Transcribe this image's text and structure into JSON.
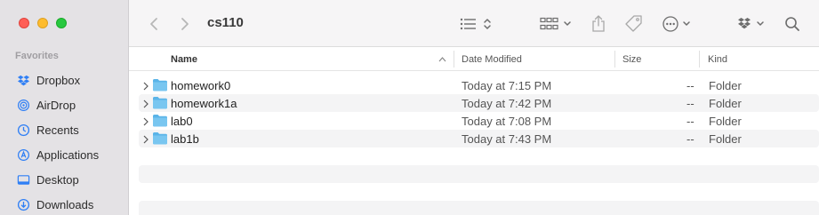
{
  "window": {
    "title": "cs110"
  },
  "sidebar": {
    "section": "Favorites",
    "items": [
      {
        "label": "Dropbox",
        "icon": "dropbox-icon"
      },
      {
        "label": "AirDrop",
        "icon": "airdrop-icon"
      },
      {
        "label": "Recents",
        "icon": "recents-icon"
      },
      {
        "label": "Applications",
        "icon": "applications-icon"
      },
      {
        "label": "Desktop",
        "icon": "desktop-icon"
      },
      {
        "label": "Downloads",
        "icon": "downloads-icon"
      }
    ]
  },
  "columns": {
    "name": "Name",
    "date": "Date Modified",
    "size": "Size",
    "kind": "Kind"
  },
  "files": [
    {
      "name": "homework0",
      "date": "Today at 7:15 PM",
      "size": "--",
      "kind": "Folder"
    },
    {
      "name": "homework1a",
      "date": "Today at 7:42 PM",
      "size": "--",
      "kind": "Folder"
    },
    {
      "name": "lab0",
      "date": "Today at 7:08 PM",
      "size": "--",
      "kind": "Folder"
    },
    {
      "name": "lab1b",
      "date": "Today at 7:43 PM",
      "size": "--",
      "kind": "Folder"
    }
  ],
  "colors": {
    "accent": "#2f7ff5",
    "folder": "#5ab4e8"
  }
}
